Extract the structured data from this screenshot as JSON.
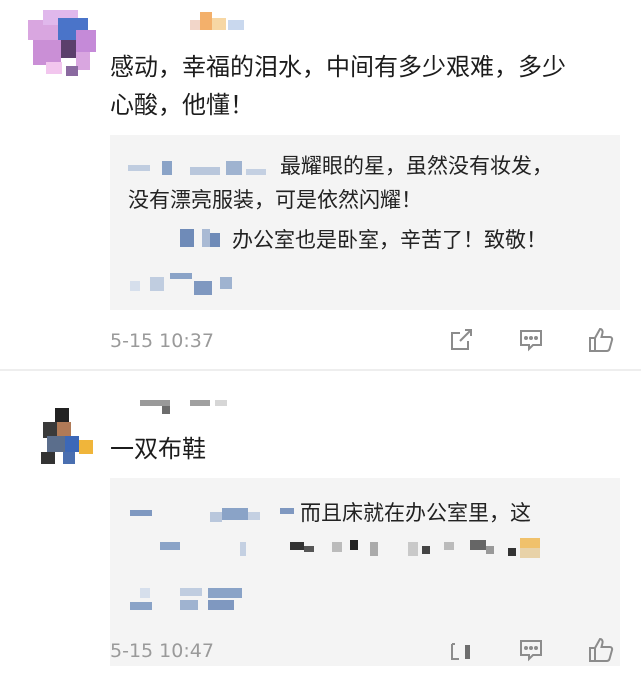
{
  "comments": [
    {
      "text_line1": "感动，幸福的泪水，中间有多少艰难，多少",
      "text_line2": "心酸，他懂！",
      "replies": [
        {
          "line1": "最耀眼的星，虽然没有妆发，",
          "line2": "没有漂亮服装，可是依然闪耀！"
        },
        {
          "line1": "办公室也是卧室，辛苦了！致敬！"
        }
      ],
      "time": "5-15 10:37",
      "actions": [
        "share-icon",
        "comment-icon",
        "like-icon"
      ]
    },
    {
      "text_line1": "一双布鞋",
      "replies": [
        {
          "line1": "而且床就在办公室里，这"
        }
      ],
      "time": "5-15 10:47",
      "actions": [
        "share-icon",
        "comment-icon",
        "like-icon"
      ]
    }
  ],
  "colors": {
    "reply_bg": "#f4f4f4",
    "meta": "#9a9a9a",
    "divider": "#eeeeee",
    "blur_blue": "#8aa3c7"
  }
}
